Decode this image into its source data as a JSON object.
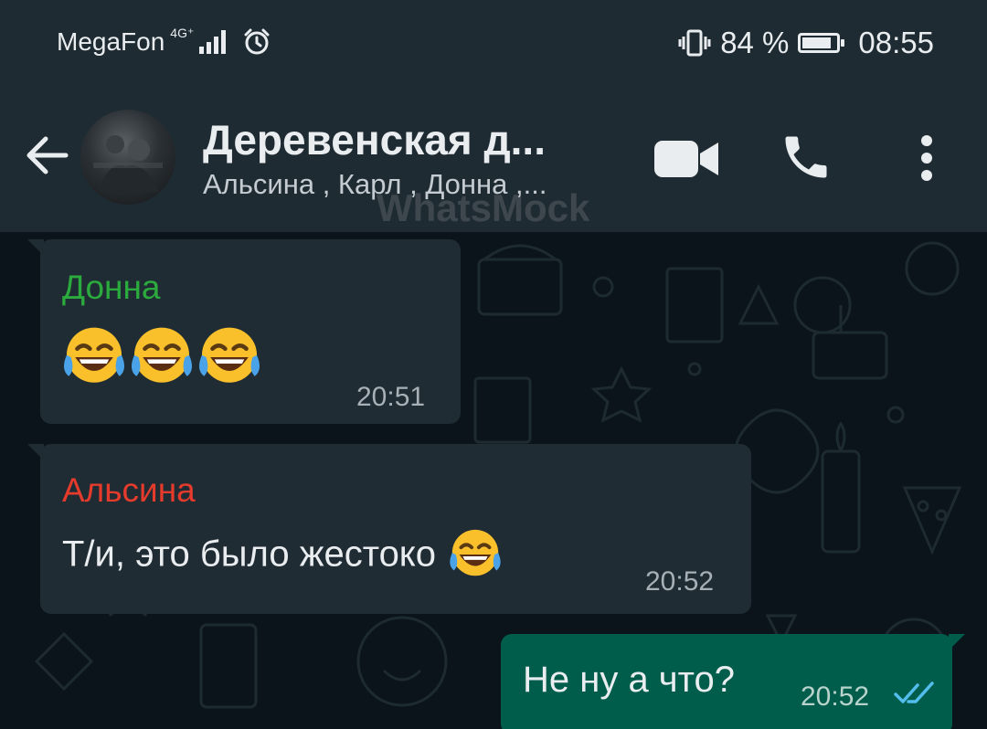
{
  "status_bar": {
    "carrier": "MegaFon",
    "network_type": "4G⁺",
    "battery_percent": "84 %",
    "battery_level": 0.84,
    "time": "08:55",
    "icons": [
      "signal-icon",
      "alarm-icon",
      "vibrate-icon",
      "battery-icon"
    ]
  },
  "header": {
    "title": "Деревенская д...",
    "subtitle": "Альсина , Карл , Донна ,...",
    "watermark": "WhatsMock",
    "icons": [
      "back-arrow-icon",
      "video-call-icon",
      "phone-icon",
      "more-options-icon"
    ]
  },
  "messages": [
    {
      "sender": "Донна",
      "sender_color": "#2bab3d",
      "text": "",
      "emoji": [
        "😂",
        "😂",
        "😂"
      ],
      "time": "20:51",
      "direction": "incoming"
    },
    {
      "sender": "Альсина",
      "sender_color": "#e53b2c",
      "text": "Т/и, это было жестоко",
      "emoji": [
        "😂"
      ],
      "time": "20:52",
      "direction": "incoming"
    },
    {
      "sender": "",
      "text": "Не ну а что?",
      "time": "20:52",
      "direction": "outgoing",
      "status": "read",
      "status_icon": "double-check-icon"
    }
  ],
  "colors": {
    "header_bg": "#1f2b33",
    "chat_bg": "#0b141a",
    "incoming_bubble": "#202c33",
    "outgoing_bubble": "#005c4b",
    "read_check": "#53bdeb"
  }
}
